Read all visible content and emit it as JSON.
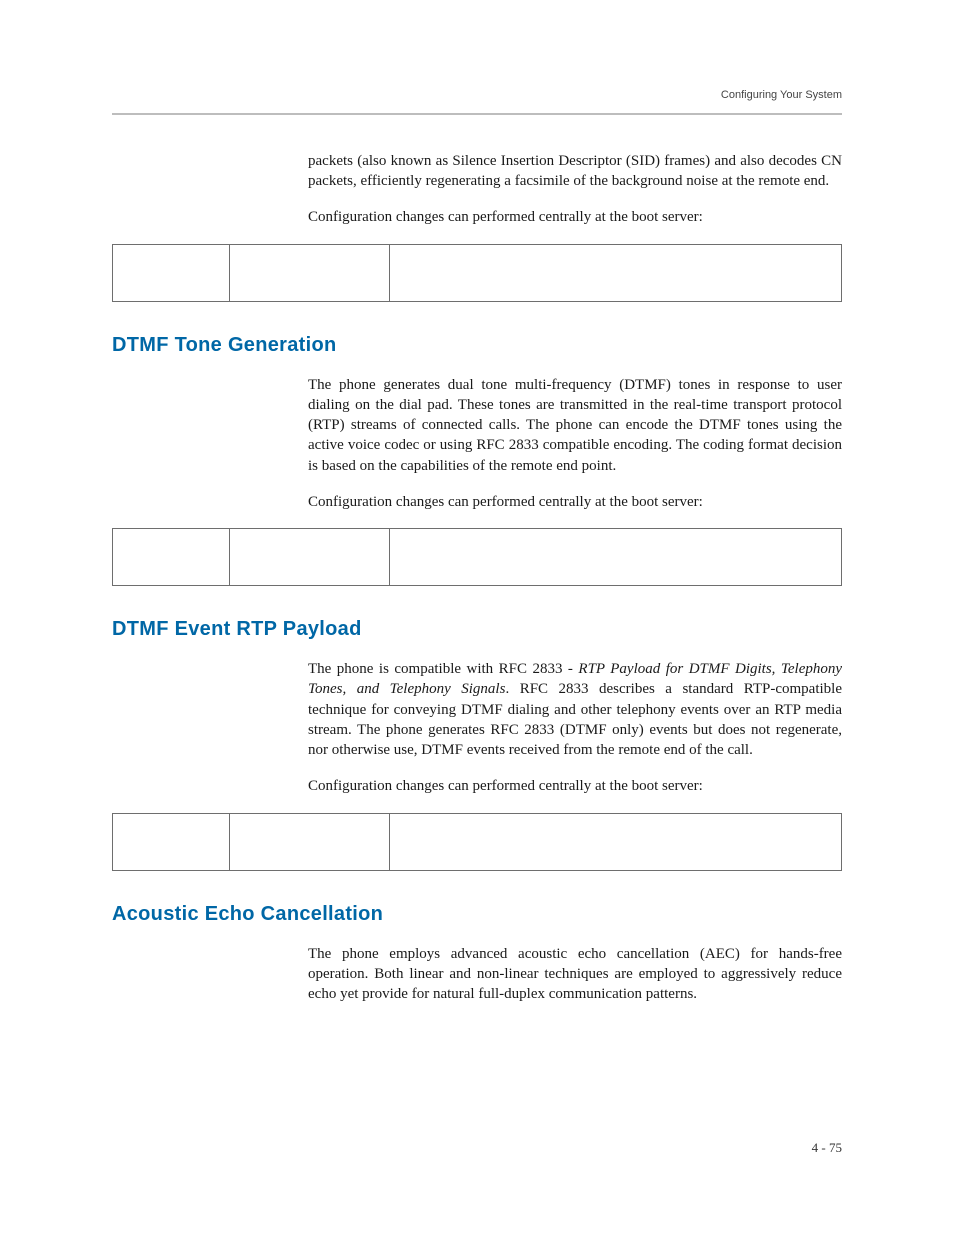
{
  "header": {
    "running_title": "Configuring Your System"
  },
  "intro": {
    "p1": "packets (also known as Silence Insertion Descriptor (SID) frames) and also decodes CN packets, efficiently regenerating a facsimile of the background noise at the remote end.",
    "p2": "Configuration changes can performed centrally at the boot server:"
  },
  "sections": {
    "dtmf_tone": {
      "title": "DTMF Tone Generation",
      "p1": "The phone generates dual tone multi-frequency (DTMF) tones in response to user dialing on the dial pad. These tones are transmitted in the real-time transport protocol (RTP) streams of connected calls. The phone can encode the DTMF tones using the active voice codec or using RFC 2833 compatible encoding. The coding format decision is based on the capabilities of the remote end point.",
      "p2": "Configuration changes can performed centrally at the boot server:"
    },
    "dtmf_payload": {
      "title": "DTMF Event RTP Payload",
      "p1_pre": "The phone is compatible with RFC 2833 - ",
      "p1_em": "RTP Payload for DTMF Digits, Telephony Tones, and Telephony Signals",
      "p1_post": ". RFC 2833 describes a standard RTP-compatible technique for conveying DTMF dialing and other telephony events over an RTP media stream. The phone generates RFC 2833 (DTMF only) events but does not regenerate, nor otherwise use, DTMF events received from the remote end of the call.",
      "p2": "Configuration changes can performed centrally at the boot server:"
    },
    "aec": {
      "title": "Acoustic Echo Cancellation",
      "p1": "The phone employs advanced acoustic echo cancellation (AEC) for hands-free operation. Both linear and non-linear techniques are employed to aggressively reduce echo yet provide for natural full-duplex communication patterns."
    }
  },
  "footer": {
    "page_label": "4 - 75"
  }
}
